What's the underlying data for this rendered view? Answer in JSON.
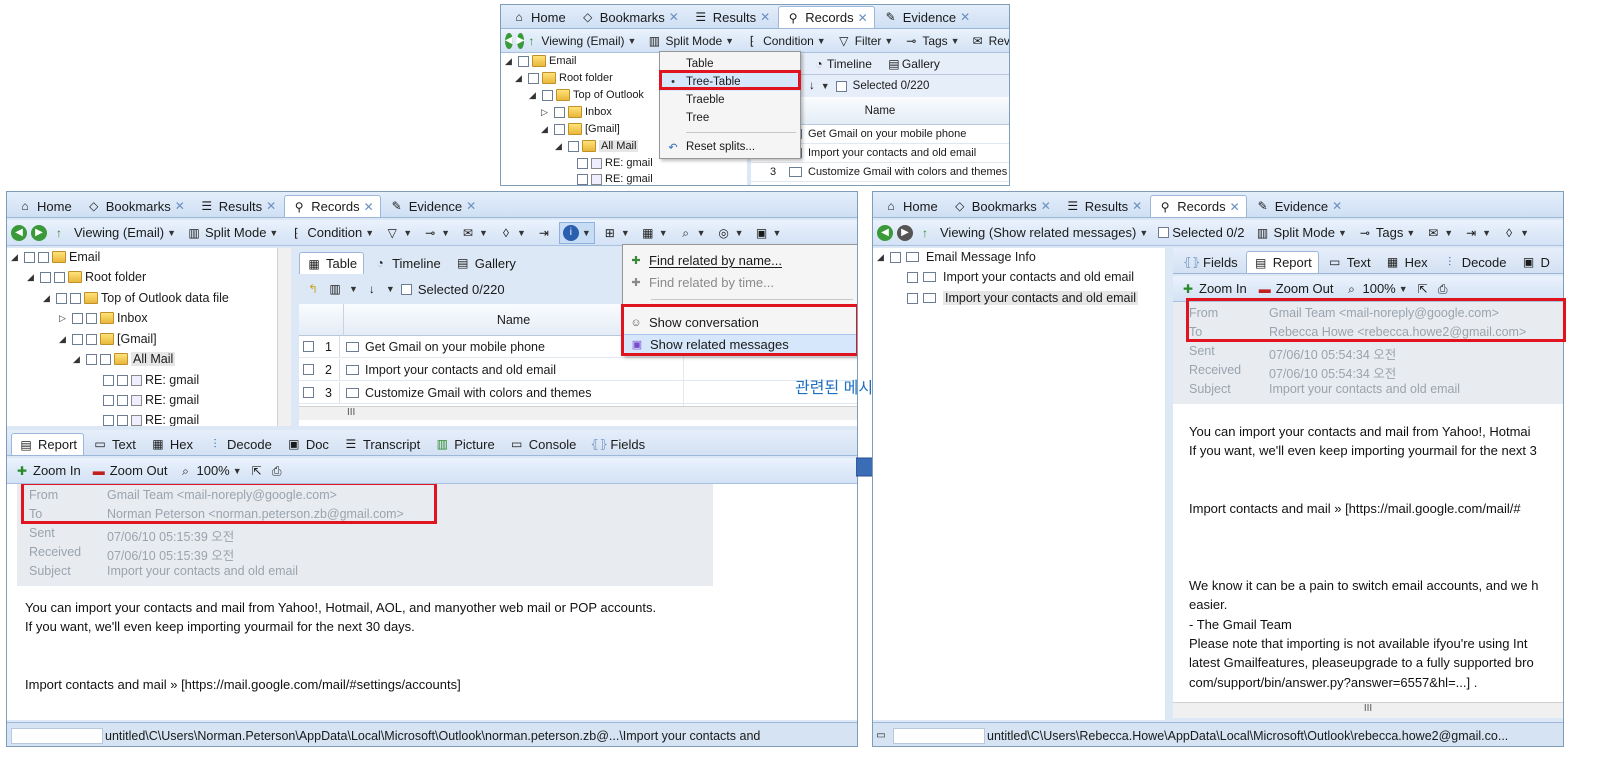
{
  "top_panel": {
    "tabs": [
      {
        "label": "Home"
      },
      {
        "label": "Bookmarks"
      },
      {
        "label": "Results"
      },
      {
        "label": "Records"
      },
      {
        "label": "Evidence"
      }
    ],
    "toolbar": {
      "viewing": "Viewing (Email)",
      "split_mode": "Split Mode",
      "condition": "Condition",
      "filter": "Filter",
      "tags": "Tags",
      "review": "Revi"
    },
    "tree": [
      "Email",
      "Root folder",
      "Top of Outlook",
      "Inbox",
      "[Gmail]",
      "All Mail",
      "RE: gmail",
      "RE: gmail"
    ],
    "subtabs": {
      "timeline": "Timeline",
      "gallery": "Gallery"
    },
    "selected": "Selected 0/220",
    "column_name": "Name",
    "rows": [
      {
        "text": "Get Gmail on your mobile phone"
      },
      {
        "text": "Import your contacts and old email"
      },
      {
        "num": "3",
        "text": "Customize Gmail with colors and themes"
      }
    ],
    "menu": {
      "items": [
        "Table",
        "Tree-Table",
        "Traeble",
        "Tree",
        "Reset splits..."
      ]
    }
  },
  "left_panel": {
    "tabs": [
      {
        "label": "Home"
      },
      {
        "label": "Bookmarks"
      },
      {
        "label": "Results"
      },
      {
        "label": "Records"
      },
      {
        "label": "Evidence"
      }
    ],
    "toolbar": {
      "viewing": "Viewing (Email)",
      "split_mode": "Split Mode",
      "condition": "Condition"
    },
    "tree": [
      "Email",
      "Root folder",
      "Top of Outlook data file",
      "Inbox",
      "[Gmail]",
      "All Mail",
      "RE: gmail",
      "RE: gmail",
      "RE: gmail"
    ],
    "subtabs": {
      "table": "Table",
      "timeline": "Timeline",
      "gallery": "Gallery"
    },
    "selected": "Selected 0/220",
    "column_name": "Name",
    "rows": [
      {
        "num": "1",
        "text": "Get Gmail on your mobile phone"
      },
      {
        "num": "2",
        "text": "Import your contacts and old email"
      },
      {
        "num": "3",
        "text": "Customize Gmail with colors and themes"
      }
    ],
    "hscroll_label": "III",
    "menu": {
      "items": [
        "Find related by name...",
        "Find related by time...",
        "Show conversation",
        "Show related messages"
      ]
    },
    "report_tabs": [
      "Report",
      "Text",
      "Hex",
      "Decode",
      "Doc",
      "Transcript",
      "Picture",
      "Console",
      "Fields"
    ],
    "zoom": {
      "zoom_in": "Zoom In",
      "zoom_out": "Zoom Out",
      "percent": "100%"
    },
    "header": {
      "from_label": "From",
      "from_value": "Gmail Team <mail-noreply@google.com>",
      "to_label": "To",
      "to_value": "Norman Peterson <norman.peterson.zb@gmail.com>",
      "sent_label": "Sent",
      "sent_value": "07/06/10 05:15:39 오전",
      "received_label": "Received",
      "received_value": "07/06/10 05:15:39 오전",
      "subject_label": "Subject",
      "subject_value": "Import your contacts and old email"
    },
    "body": [
      "You can import your contacts and mail from Yahoo!, Hotmail, AOL, and manyother web mail or POP accounts.",
      "If you want, we'll even keep importing yourmail for the next 30 days.",
      "Import contacts and mail » [https://mail.google.com/mail/#settings/accounts]"
    ],
    "status_path": "untitled\\C\\Users\\Norman.Peterson\\AppData\\Local\\Microsoft\\Outlook\\norman.peterson.zb@...\\Import your contacts and"
  },
  "annotation": {
    "label": "관련된 메시지 찾기"
  },
  "right_panel": {
    "tabs": [
      {
        "label": "Home"
      },
      {
        "label": "Bookmarks"
      },
      {
        "label": "Results"
      },
      {
        "label": "Records"
      },
      {
        "label": "Evidence"
      }
    ],
    "toolbar": {
      "viewing": "Viewing (Show related messages)",
      "selected": "Selected 0/2",
      "split_mode": "Split Mode",
      "tags": "Tags"
    },
    "tree": [
      "Email Message Info",
      "Import your contacts and old email",
      "Import your contacts and old email"
    ],
    "report_tabs": [
      "Fields",
      "Report",
      "Text",
      "Hex",
      "Decode",
      "D"
    ],
    "zoom": {
      "zoom_in": "Zoom In",
      "zoom_out": "Zoom Out",
      "percent": "100%"
    },
    "header": {
      "from_label": "From",
      "from_value": "Gmail Team <mail-noreply@google.com>",
      "to_label": "To",
      "to_value": "Rebecca Howe <rebecca.howe2@gmail.com>",
      "sent_label": "Sent",
      "sent_value": "07/06/10 05:54:34 오전",
      "received_label": "Received",
      "received_value": "07/06/10 05:54:34 오전",
      "subject_label": "Subject",
      "subject_value": "Import your contacts and old email"
    },
    "body": [
      "You can import your contacts and mail from Yahoo!, Hotmai",
      "If you want, we'll even keep importing yourmail for the next 3",
      "Import contacts and mail » [https://mail.google.com/mail/#",
      "We know it can be a pain to switch email accounts, and we h",
      "easier.",
      "- The Gmail Team",
      "Please note that importing is not available ifyou're using Int",
      "latest Gmailfeatures, pleaseupgrade to a fully supported bro",
      "com/support/bin/answer.py?answer=6557&hl=...] ."
    ],
    "hscroll_label": "III",
    "status_path": "untitled\\C\\Users\\Rebecca.Howe\\AppData\\Local\\Microsoft\\Outlook\\rebecca.howe2@gmail.co..."
  },
  "colors": {
    "highlight": "#e0141e",
    "arrow": "#3a6db5",
    "annotation_text": "#1f6fc0"
  }
}
